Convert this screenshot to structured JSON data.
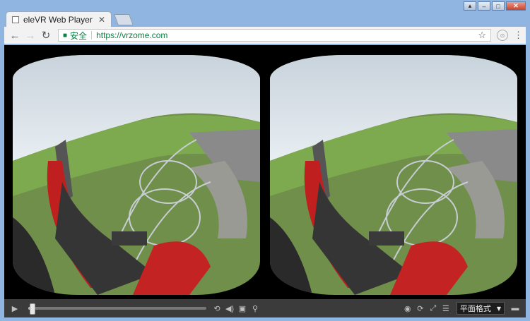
{
  "browser": {
    "tab_title": "eleVR Web Player",
    "tab_close": "✕",
    "security_label": "安全",
    "url": "https://vrzome.com",
    "back_icon": "←",
    "forward_icon": "→",
    "reload_icon": "↻",
    "bookmark_icon": "☆",
    "menu_icon": "⋮",
    "extension_icon": "⊙"
  },
  "window_controls": {
    "user": "▴",
    "minimize": "‒",
    "maximize": "□",
    "close": "✕"
  },
  "player": {
    "play_icon": "▶",
    "playback_progress": 0.02,
    "format_label": "平面格式",
    "format_caret": "▼",
    "icons": {
      "loop": "⟲",
      "volume": "◀)",
      "vr": "▣",
      "zoom": "⚲",
      "gyro": "◉",
      "recenter": "⟳",
      "fullscreen": "⤢",
      "mode": "☰",
      "folder": "▬"
    }
  },
  "colors": {
    "url_green": "#0b8043",
    "control_bar": "#3b3b3b",
    "frame_blue": "#8fb5e0"
  }
}
